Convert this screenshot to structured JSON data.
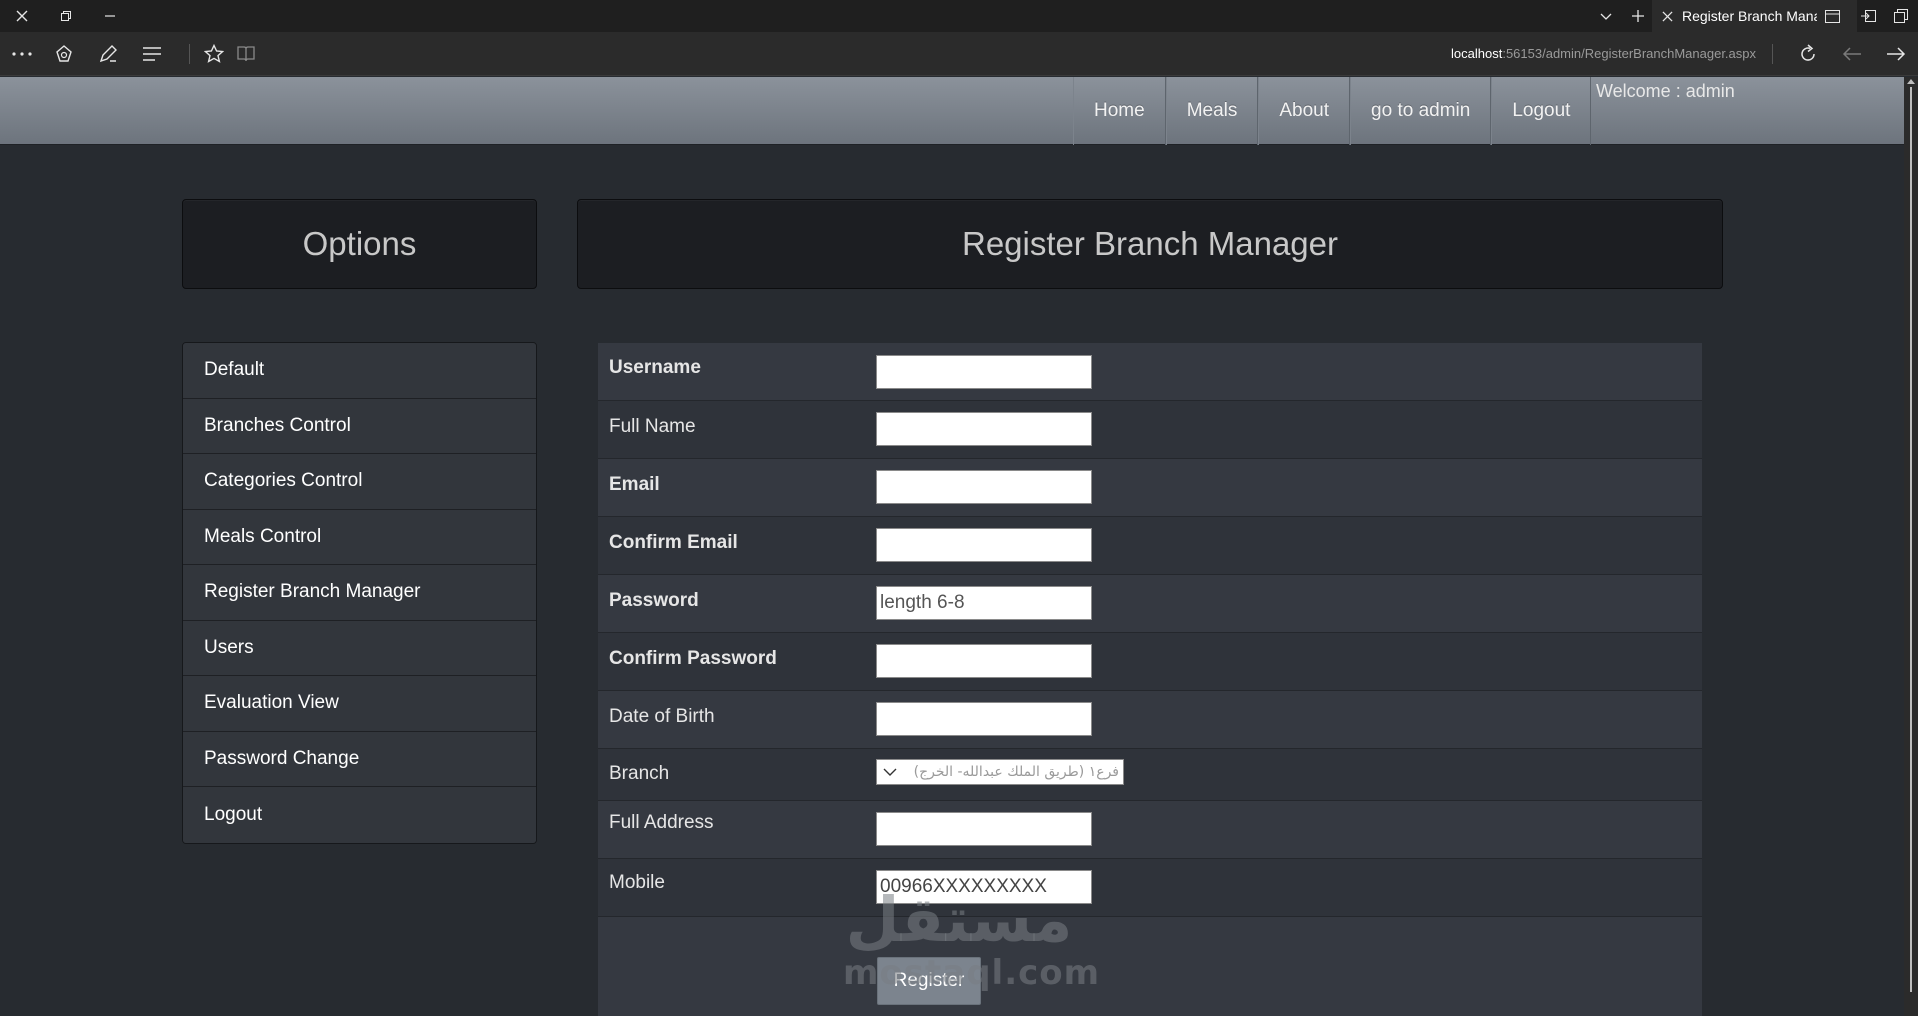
{
  "browser": {
    "tab_title": "Register Branch Manager",
    "address_host": "localhost",
    "address_path": ":56153/admin/RegisterBranchManager.aspx"
  },
  "navbar": {
    "items": [
      {
        "label": "Home"
      },
      {
        "label": "Meals"
      },
      {
        "label": "About"
      },
      {
        "label": "go to admin"
      },
      {
        "label": "Logout"
      }
    ],
    "welcome": "Welcome : admin"
  },
  "sidebar": {
    "title": "Options",
    "items": [
      {
        "label": "Default"
      },
      {
        "label": "Branches Control"
      },
      {
        "label": "Categories Control"
      },
      {
        "label": "Meals Control"
      },
      {
        "label": "Register Branch Manager"
      },
      {
        "label": "Users"
      },
      {
        "label": "Evaluation View"
      },
      {
        "label": "Password Change"
      },
      {
        "label": "Logout"
      }
    ]
  },
  "form": {
    "title": "Register Branch Manager",
    "fields": {
      "username": {
        "label": "Username",
        "value": ""
      },
      "full_name": {
        "label": "Full Name",
        "value": ""
      },
      "email": {
        "label": "Email",
        "value": ""
      },
      "confirm_email": {
        "label": "Confirm Email",
        "value": ""
      },
      "password": {
        "label": "Password",
        "placeholder": "length 6-8"
      },
      "confirm_password": {
        "label": "Confirm Password",
        "value": ""
      },
      "date_of_birth": {
        "label": "Date of Birth",
        "value": ""
      },
      "branch": {
        "label": "Branch",
        "selected": "فرع١ (طريق الملك عبدالله- الخرج)"
      },
      "full_address": {
        "label": "Full Address",
        "value": ""
      },
      "mobile": {
        "label": "Mobile",
        "value": "00966XXXXXXXXX"
      }
    },
    "register_label": "Register"
  },
  "watermark": {
    "arabic": "مستقل",
    "latin": "mostaql.com"
  }
}
